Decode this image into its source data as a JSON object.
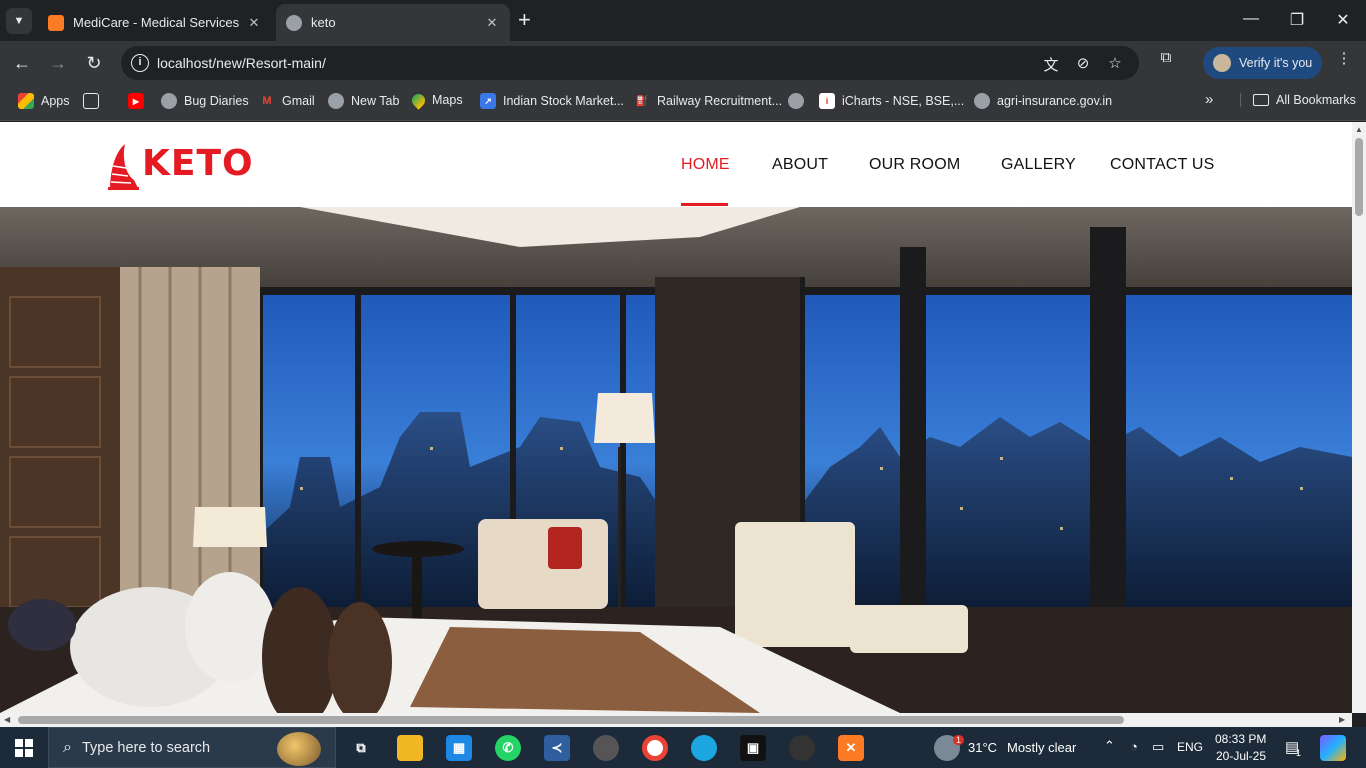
{
  "browser": {
    "tabs": [
      {
        "title": "MediCare - Medical Services",
        "active": false
      },
      {
        "title": "keto",
        "active": true
      }
    ],
    "new_tab_label": "+",
    "url": "localhost/new/Resort-main/",
    "verify_label": "Verify it's you",
    "bookmarks": [
      {
        "label": "Apps",
        "icon": "apps-grid-icon"
      },
      {
        "label": "",
        "icon": "grid-icon"
      },
      {
        "label": "",
        "icon": "youtube-icon"
      },
      {
        "label": "Bug Diaries",
        "icon": "globe-icon"
      },
      {
        "label": "Gmail",
        "icon": "gmail-icon"
      },
      {
        "label": "New Tab",
        "icon": "globe-icon"
      },
      {
        "label": "Maps",
        "icon": "maps-icon"
      },
      {
        "label": "Indian Stock Market...",
        "icon": "stock-icon"
      },
      {
        "label": "Railway Recruitment...",
        "icon": "railway-icon"
      },
      {
        "label": "",
        "icon": "globe-icon"
      },
      {
        "label": "iCharts - NSE, BSE,...",
        "icon": "icharts-icon"
      },
      {
        "label": "agri-insurance.gov.in",
        "icon": "globe-icon"
      }
    ],
    "more_bookmarks": "»",
    "all_bookmarks": "All Bookmarks"
  },
  "site": {
    "logo_text": "KETO",
    "nav": [
      {
        "label": "HOME",
        "active": true
      },
      {
        "label": "ABOUT",
        "active": false
      },
      {
        "label": "OUR ROOM",
        "active": false
      },
      {
        "label": "GALLERY",
        "active": false
      },
      {
        "label": "CONTACT US",
        "active": false
      }
    ],
    "hero_image": "hotel-bedroom-city-view"
  },
  "taskbar": {
    "search_placeholder": "Type here to search",
    "weather_temp": "31°C",
    "weather_text": "Mostly clear",
    "language": "ENG",
    "time": "08:33 PM",
    "date": "20-Jul-25",
    "notification_count": "1",
    "weather_badge": "1"
  },
  "colors": {
    "brand_red": "#e41b23",
    "chrome_dark": "#202124",
    "chrome_toolbar": "#35363a",
    "verify_blue": "#1f4a80"
  }
}
